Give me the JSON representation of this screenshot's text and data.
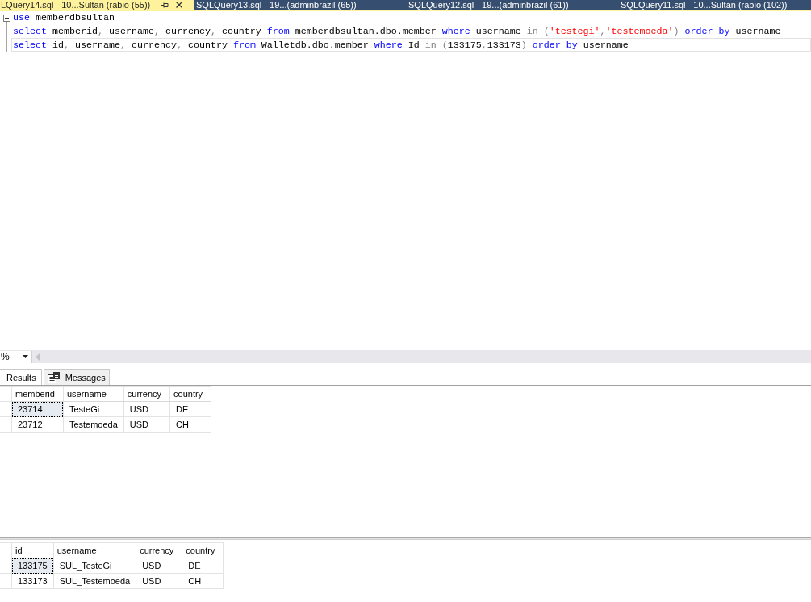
{
  "document_tabs": [
    {
      "label": "LQuery14.sql - 10...Sultan (rabio (55))",
      "selected": true
    },
    {
      "label": "SQLQuery13.sql - 19...(adminbrazil (65))",
      "selected": false
    },
    {
      "label": "SQLQuery12.sql - 19...(adminbrazil (61))",
      "selected": false
    },
    {
      "label": "SQLQuery11.sql - 10...Sultan (rabio (102))",
      "selected": false
    }
  ],
  "editor": {
    "block_expanded": true,
    "lines": [
      {
        "current": false,
        "tokens": [
          {
            "kind": "keyword",
            "text": "use"
          },
          {
            "kind": "text",
            "text": " memberdbsultan"
          }
        ]
      },
      {
        "current": false,
        "tokens": [
          {
            "kind": "keyword",
            "text": "select"
          },
          {
            "kind": "text",
            "text": " memberid"
          },
          {
            "kind": "operator",
            "text": ","
          },
          {
            "kind": "text",
            "text": " username"
          },
          {
            "kind": "operator",
            "text": ","
          },
          {
            "kind": "text",
            "text": " currency"
          },
          {
            "kind": "operator",
            "text": ","
          },
          {
            "kind": "text",
            "text": " country "
          },
          {
            "kind": "keyword",
            "text": "from"
          },
          {
            "kind": "text",
            "text": " memberdbsultan.dbo.member "
          },
          {
            "kind": "keyword",
            "text": "where"
          },
          {
            "kind": "text",
            "text": " username "
          },
          {
            "kind": "operator",
            "text": "in ("
          },
          {
            "kind": "string",
            "text": "'testegi'"
          },
          {
            "kind": "operator",
            "text": ","
          },
          {
            "kind": "string",
            "text": "'testemoeda'"
          },
          {
            "kind": "operator",
            "text": ") "
          },
          {
            "kind": "keyword",
            "text": "order by"
          },
          {
            "kind": "text",
            "text": " username"
          }
        ]
      },
      {
        "current": true,
        "tokens": [
          {
            "kind": "keyword",
            "text": "select"
          },
          {
            "kind": "text",
            "text": " id"
          },
          {
            "kind": "operator",
            "text": ","
          },
          {
            "kind": "text",
            "text": " username"
          },
          {
            "kind": "operator",
            "text": ","
          },
          {
            "kind": "text",
            "text": " currency"
          },
          {
            "kind": "operator",
            "text": ","
          },
          {
            "kind": "text",
            "text": " country "
          },
          {
            "kind": "keyword",
            "text": "from"
          },
          {
            "kind": "text",
            "text": " Walletdb.dbo.member "
          },
          {
            "kind": "keyword",
            "text": "where"
          },
          {
            "kind": "text",
            "text": " Id "
          },
          {
            "kind": "operator",
            "text": "in ("
          },
          {
            "kind": "text",
            "text": "133175"
          },
          {
            "kind": "operator",
            "text": ","
          },
          {
            "kind": "text",
            "text": "133173"
          },
          {
            "kind": "operator",
            "text": ") "
          },
          {
            "kind": "keyword",
            "text": "order by"
          },
          {
            "kind": "text",
            "text": " username"
          }
        ]
      }
    ]
  },
  "zoom": {
    "value": "%"
  },
  "result_tabs": [
    {
      "label": "Results",
      "kind": "results",
      "selected": true
    },
    {
      "label": "Messages",
      "kind": "messages",
      "selected": false
    }
  ],
  "result_grids": [
    {
      "columns": [
        "memberid",
        "username",
        "currency",
        "country"
      ],
      "rows": [
        {
          "selected": true,
          "cells": [
            "23714",
            "TesteGi",
            "USD",
            "DE"
          ]
        },
        {
          "selected": false,
          "cells": [
            "23712",
            "Testemoeda",
            "USD",
            "CH"
          ]
        }
      ]
    },
    {
      "columns": [
        "id",
        "username",
        "currency",
        "country"
      ],
      "rows": [
        {
          "selected": true,
          "cells": [
            "133175",
            "SUL_TesteGi",
            "USD",
            "DE"
          ]
        },
        {
          "selected": false,
          "cells": [
            "133173",
            "SUL_Testemoeda",
            "USD",
            "CH"
          ]
        }
      ]
    }
  ]
}
